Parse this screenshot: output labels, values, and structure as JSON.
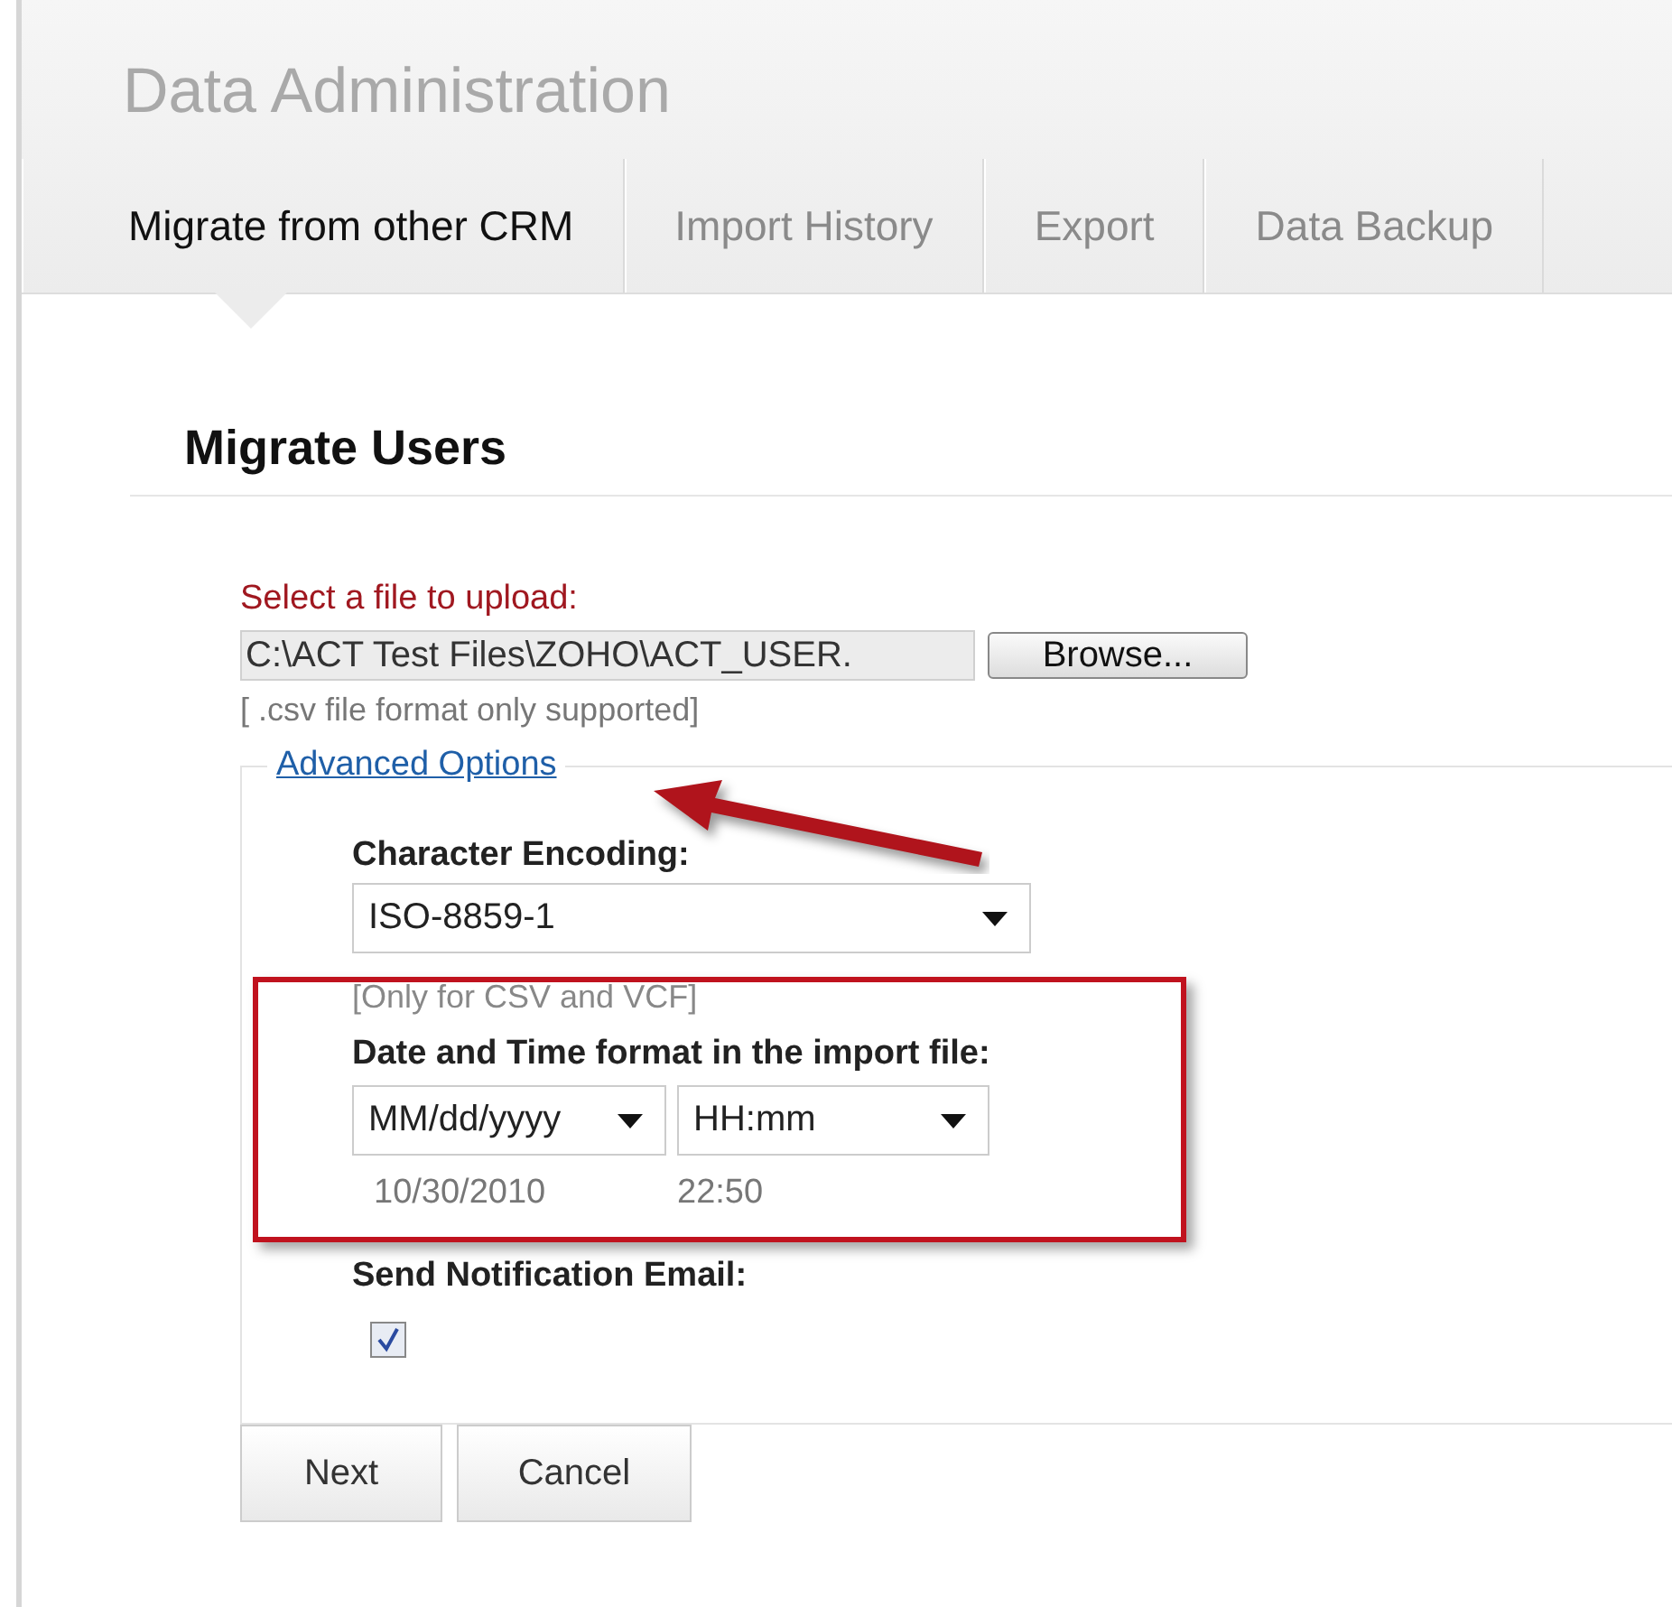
{
  "header": {
    "title": "Data Administration"
  },
  "tabs": [
    {
      "label": "Migrate from other CRM",
      "selected": true
    },
    {
      "label": "Import History",
      "selected": false
    },
    {
      "label": "Export",
      "selected": false
    },
    {
      "label": "Data Backup",
      "selected": false
    }
  ],
  "section_title": "Migrate Users",
  "upload": {
    "label": "Select a file to upload:",
    "value": "C:\\ACT Test Files\\ZOHO\\ACT_USER.",
    "browse_button": "Browse...",
    "hint": "[ .csv file format only supported]"
  },
  "advanced": {
    "link": "Advanced Options",
    "encoding": {
      "label": "Character Encoding:",
      "value": "ISO-8859-1",
      "note": "[Only for CSV and VCF]"
    },
    "datetime": {
      "label": "Date and Time format in the import file:",
      "date_format": "MM/dd/yyyy",
      "time_format": "HH:mm",
      "date_example": "10/30/2010",
      "time_example": "22:50"
    },
    "notification": {
      "label": "Send Notification Email:",
      "checked": true
    }
  },
  "buttons": [
    "Next",
    "Cancel"
  ]
}
